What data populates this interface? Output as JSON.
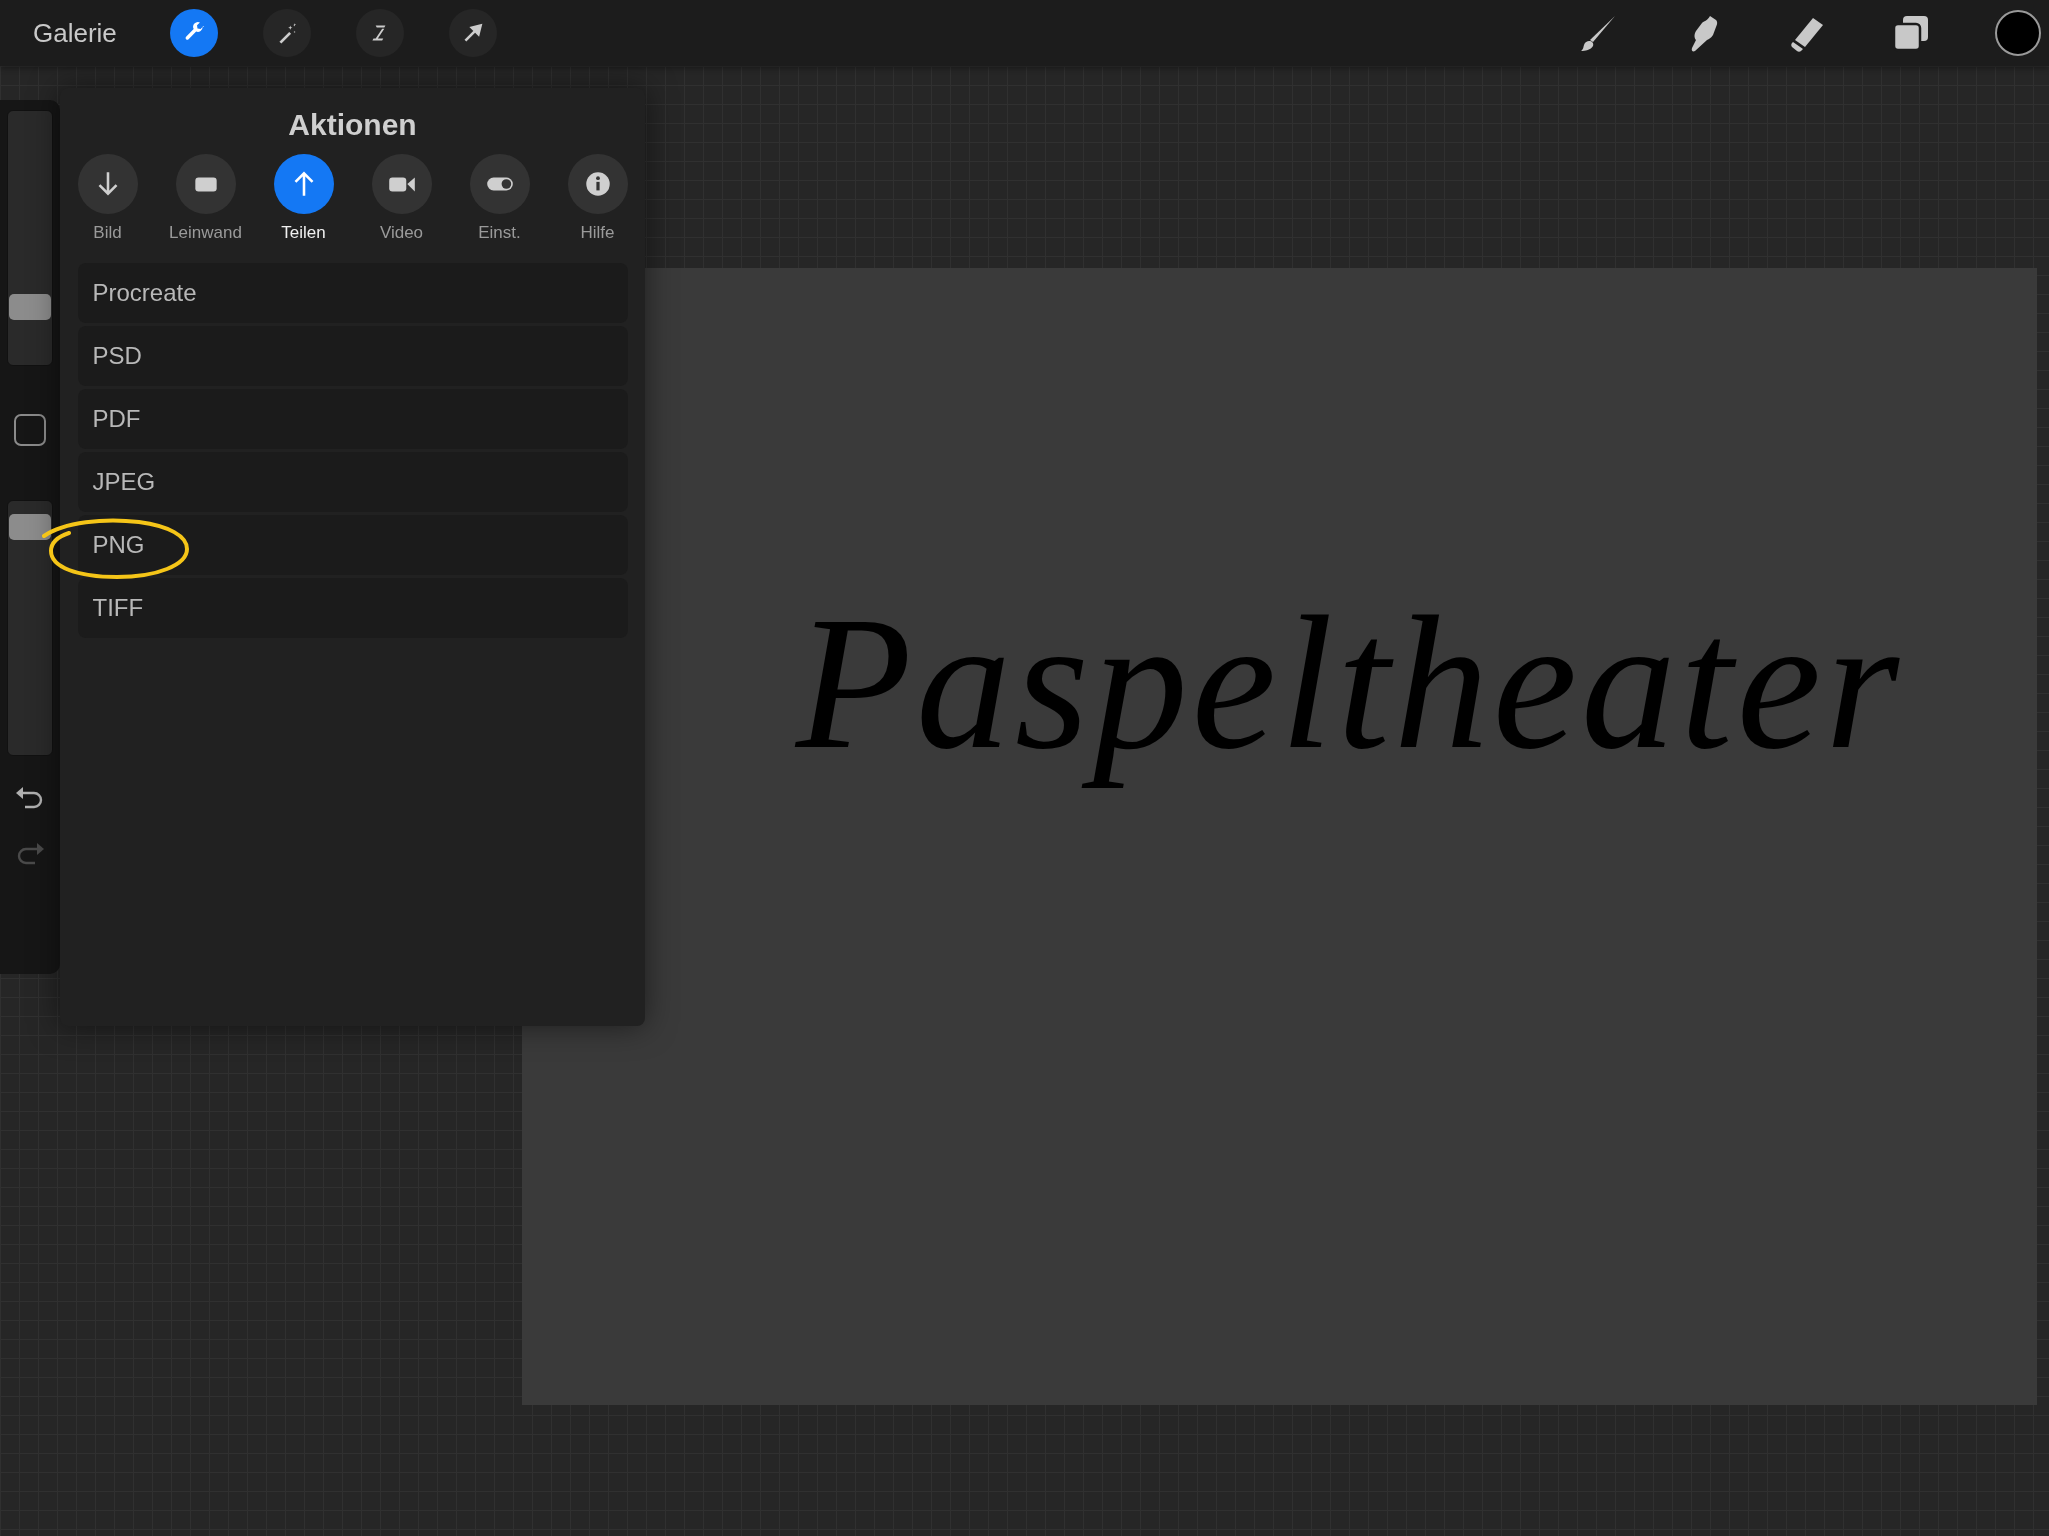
{
  "top_bar": {
    "gallery": "Galerie",
    "left_tools": [
      {
        "kind": "wrench",
        "selected": true
      },
      {
        "kind": "wand",
        "selected": false
      },
      {
        "kind": "selection",
        "selected": false
      },
      {
        "kind": "transform",
        "selected": false
      }
    ],
    "right_tools": [
      {
        "kind": "brush",
        "selected": false
      },
      {
        "kind": "smudge",
        "selected": false
      },
      {
        "kind": "eraser",
        "selected": false
      },
      {
        "kind": "layers",
        "selected": false
      }
    ]
  },
  "sidebar": {
    "sliders": [
      {
        "level": 0.2
      },
      {
        "level": 0.95
      }
    ],
    "undo": {
      "disabled": false
    },
    "redo": {
      "disabled": true
    }
  },
  "actions_panel": {
    "title": "Aktionen",
    "tabs": [
      {
        "label": "Bild",
        "selected": false
      },
      {
        "label": "Leinwand",
        "selected": false
      },
      {
        "label": "Teilen",
        "selected": true
      },
      {
        "label": "Video",
        "selected": false
      },
      {
        "label": "Einst.",
        "selected": false
      },
      {
        "label": "Hilfe",
        "selected": false
      }
    ],
    "export_formats": [
      "Procreate",
      "PSD",
      "PDF",
      "JPEG",
      "PNG",
      "TIFF"
    ]
  },
  "canvas": {
    "lettering": "Paspeltheater"
  }
}
